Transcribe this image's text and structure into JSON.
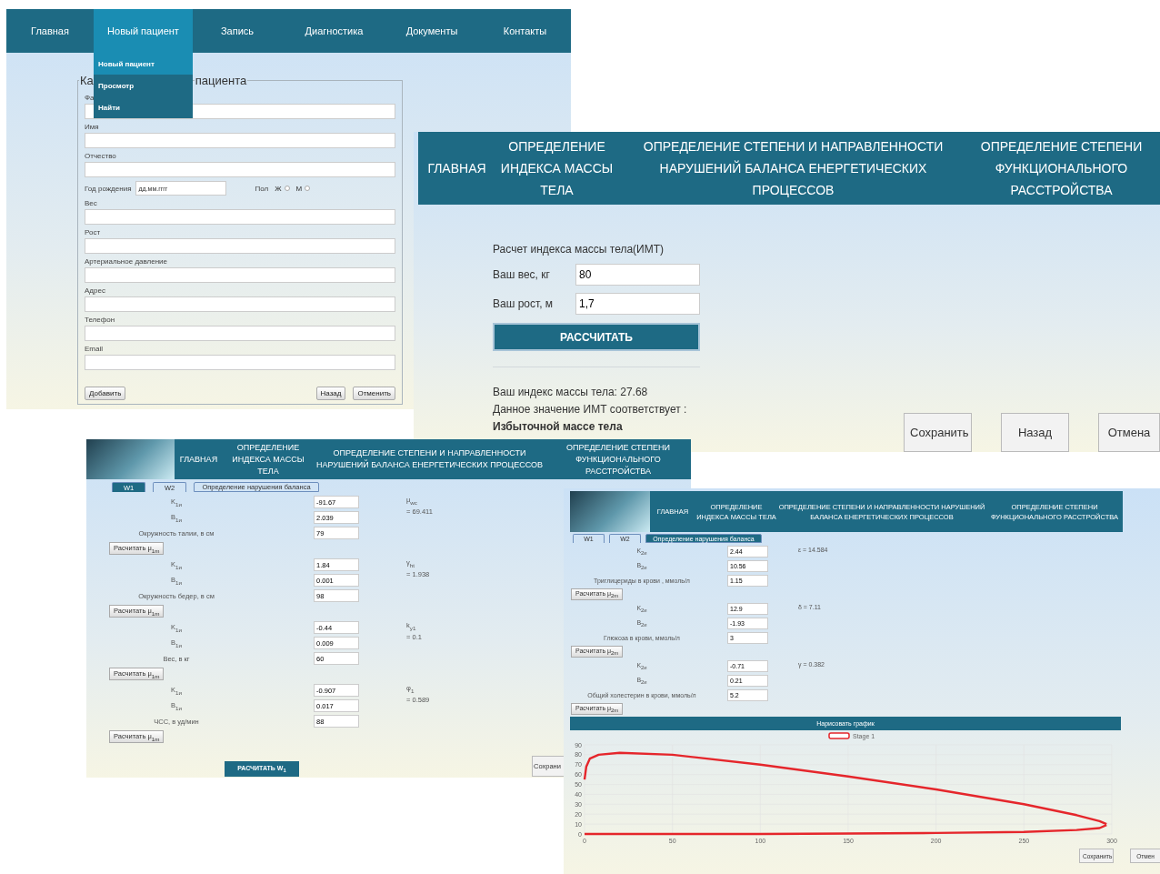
{
  "patient_form_screen": {
    "nav": [
      {
        "label": "Главная",
        "selected": false
      },
      {
        "label": "Новый пациент",
        "selected": true
      },
      {
        "label": "Запись",
        "selected": false
      },
      {
        "label": "Диагностика",
        "selected": false
      },
      {
        "label": "Документы",
        "selected": false
      },
      {
        "label": "Контакты",
        "selected": false
      }
    ],
    "dropdown": [
      {
        "label": "Новый пациент",
        "selected": true
      },
      {
        "label": "Просмотр",
        "selected": false
      },
      {
        "label": "Найти",
        "selected": false
      }
    ],
    "legend_parts": [
      "Ка",
      "пациента"
    ],
    "fields": [
      {
        "kind": "text",
        "label": "Фа"
      },
      {
        "kind": "text",
        "label": "Имя"
      },
      {
        "kind": "text",
        "label": "Отчество"
      },
      {
        "kind": "birth_gender",
        "label": "Год рождения",
        "placeholder": "дд.мм.гггг",
        "gender_label": "Пол",
        "options": [
          {
            "label": "Ж",
            "selected": false
          },
          {
            "label": "М",
            "selected": false
          }
        ]
      },
      {
        "kind": "text",
        "label": "Вес"
      },
      {
        "kind": "text",
        "label": "Рост"
      },
      {
        "kind": "text",
        "label": "Артериальное давление"
      },
      {
        "kind": "text",
        "label": "Адрес"
      },
      {
        "kind": "text",
        "label": "Телефон"
      },
      {
        "kind": "text",
        "label": "Email"
      }
    ],
    "buttons_left": [
      "Добавить"
    ],
    "buttons_right": [
      "Назад",
      "Отменить"
    ]
  },
  "bmi_screen": {
    "nav": [
      "ГЛАВНАЯ",
      "ОПРЕДЕЛЕНИЕ ИНДЕКСА МАССЫ ТЕЛА",
      "ОПРЕДЕЛЕНИЕ СТЕПЕНИ И НАПРАВЛЕННОСТИ НАРУШЕНИЙ БАЛАНСА ЕНЕРГЕТИЧЕСКИХ ПРОЦЕССОВ",
      "ОПРЕДЕЛЕНИЕ СТЕПЕНИ ФУНКЦИОНАЛЬНОГО РАССТРОЙСТВА"
    ],
    "title": "Расчет индекса массы тела(ИМТ)",
    "inputs": [
      {
        "label": "Ваш вес, кг",
        "value": "80"
      },
      {
        "label": "Ваш рост, м",
        "value": "1,7"
      }
    ],
    "calc_button": "РАССЧИТАТЬ",
    "result": "Ваш индекс массы тела: 27.68",
    "result_note": "Данное значение ИМТ соответствует :",
    "verdict": "Избыточной массе тела",
    "buttons": [
      "Сохранить",
      "Назад",
      "Отмена"
    ]
  },
  "w1_screen": {
    "nav": [
      "ГЛАВНАЯ",
      "ОПРЕДЕЛЕНИЕ ИНДЕКСА МАССЫ ТЕЛА",
      "ОПРЕДЕЛЕНИЕ СТЕПЕНИ И НАПРАВЛЕННОСТИ НАРУШЕНИЙ БАЛАНСА ЕНЕРГЕТИЧЕСКИХ ПРОЦЕССОВ",
      "ОПРЕДЕЛЕНИЕ СТЕПЕНИ ФУНКЦИОНАЛЬНОГО РАССТРОЙСТВА"
    ],
    "tabs": [
      {
        "label": "W1",
        "selected": true
      },
      {
        "label": "W2",
        "selected": false
      },
      {
        "label": "Определение нарушения баланса",
        "selected": false
      }
    ],
    "groups": [
      {
        "fields": [
          {
            "label": "K$_{1и}$",
            "value": "-91.67"
          },
          {
            "label": "B$_{1и}$",
            "value": "2.039"
          },
          {
            "label": "Окружность талии, в см",
            "value": "79"
          }
        ],
        "result": [
          "μ$_{wc}$",
          "= 69.411"
        ],
        "button": "Расчитать μ$_{1m}$"
      },
      {
        "fields": [
          {
            "label": "K$_{1и}$",
            "value": "1.84"
          },
          {
            "label": "B$_{1и}$",
            "value": "0.001"
          },
          {
            "label": "Окружность бедер, в см",
            "value": "98"
          }
        ],
        "result": [
          "γ$_{ht}$",
          "= 1.938"
        ],
        "button": "Расчитать μ$_{1m}$"
      },
      {
        "fields": [
          {
            "label": "K$_{1и}$",
            "value": "-0.44"
          },
          {
            "label": "B$_{1и}$",
            "value": "0.009"
          },
          {
            "label": "Вес, в кг",
            "value": "60"
          }
        ],
        "result": [
          "k$_{y1}$",
          "= 0.1"
        ],
        "button": "Расчитать μ$_{1m}$"
      },
      {
        "fields": [
          {
            "label": "K$_{1и}$",
            "value": "-0.907"
          },
          {
            "label": "B$_{1и}$",
            "value": "0.017"
          },
          {
            "label": "ЧСС, в уд/мин",
            "value": "88"
          }
        ],
        "result": [
          "φ$_{1}$",
          "= 0.589"
        ],
        "button": "Расчитать μ$_{1m}$"
      }
    ],
    "main_button": "РАСЧИТАТЬ W$_{1}$",
    "save_button": "Сохрани"
  },
  "balance_screen": {
    "nav": [
      "ГЛАВНАЯ",
      "ОПРЕДЕЛЕНИЕ ИНДЕКСА МАССЫ ТЕЛА",
      "ОПРЕДЕЛЕНИЕ СТЕПЕНИ И НАПРАВЛЕННОСТИ НАРУШЕНИЙ БАЛАНСА ЕНЕРГЕТИЧЕСКИХ ПРОЦЕССОВ",
      "ОПРЕДЕЛЕНИЕ СТЕПЕНИ ФУНКЦИОНАЛЬНОГО РАССТРОЙСТВА"
    ],
    "tabs": [
      {
        "label": "W1",
        "selected": false
      },
      {
        "label": "W2",
        "selected": false
      },
      {
        "label": "Определение нарушения баланса",
        "selected": true
      }
    ],
    "groups": [
      {
        "fields": [
          {
            "label": "K$_{2и}$",
            "value": "2.44"
          },
          {
            "label": "B$_{2и}$",
            "value": "10.56"
          },
          {
            "label": "Триглицериды в крови , ммоль/л",
            "value": "1.15"
          }
        ],
        "result": [
          "ε = 14.584"
        ],
        "button": "Расчитать μ$_{2m}$"
      },
      {
        "fields": [
          {
            "label": "K$_{2и}$",
            "value": "12.9"
          },
          {
            "label": "B$_{2и}$",
            "value": "-1.93"
          },
          {
            "label": "Глюкоза в крови, ммоль/л",
            "value": "3"
          }
        ],
        "result": [
          "δ = 7.11"
        ],
        "button": "Расчитать μ$_{2m}$"
      },
      {
        "fields": [
          {
            "label": "K$_{2и}$",
            "value": "-0.71"
          },
          {
            "label": "B$_{2и}$",
            "value": "0.21"
          },
          {
            "label": "Общий холестерин в крови, ммоль/л",
            "value": "5.2"
          }
        ],
        "result": [
          "γ = 0.382"
        ],
        "button": "Расчитать μ$_{2m}$"
      }
    ],
    "plot_button": "Нарисовать график",
    "chart_data": {
      "type": "line",
      "x": [
        0,
        1,
        3,
        8,
        20,
        50,
        100,
        150,
        200,
        250,
        280,
        293,
        297
      ],
      "series": [
        {
          "name": "Stage 1",
          "color": "#e5262b",
          "values": [
            55,
            68,
            76,
            80,
            82,
            80,
            70,
            58,
            45,
            30,
            19,
            13,
            10
          ]
        },
        {
          "color": "#e5262b",
          "values": [
            0,
            0,
            0,
            0,
            0,
            0,
            0,
            0.5,
            1,
            2,
            4,
            6,
            9
          ]
        }
      ],
      "grid": true,
      "xlim": [
        0,
        300
      ],
      "ylim": [
        0,
        90
      ],
      "xticks": [
        0,
        50,
        100,
        150,
        200,
        250,
        300
      ],
      "yticks": [
        0,
        10,
        20,
        30,
        40,
        50,
        60,
        70,
        80,
        90
      ]
    },
    "buttons": [
      "Сохранить",
      "Отмен"
    ]
  }
}
